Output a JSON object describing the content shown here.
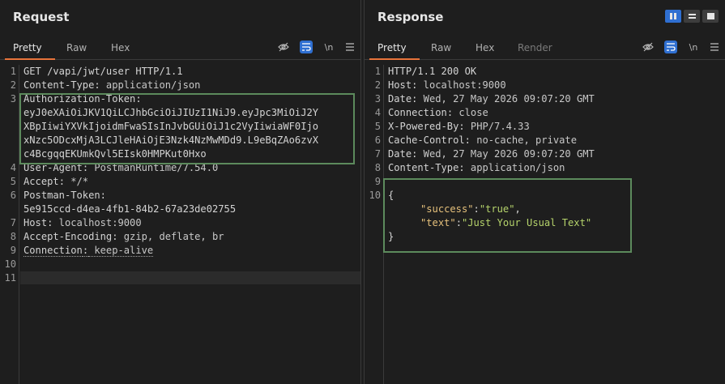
{
  "request": {
    "title": "Request",
    "tabs": [
      {
        "label": "Pretty",
        "active": true
      },
      {
        "label": "Raw",
        "active": false
      },
      {
        "label": "Hex",
        "active": false
      }
    ],
    "toolbar": {
      "newline_label": "\\n"
    },
    "lines": [
      {
        "num": "1",
        "name": "GET /vapi/jwt/user HTTP/1.1",
        "value": ""
      },
      {
        "num": "2",
        "name": "Content-Type",
        "value": " application/json"
      },
      {
        "num": "3",
        "name": "Authorization-Token",
        "value": ""
      },
      {
        "num": "",
        "name": "",
        "value": "eyJ0eXAiOiJKV1QiLCJhbGciOiJIUzI1NiJ9.eyJpc3MiOiJ2Y"
      },
      {
        "num": "",
        "name": "",
        "value": "XBpIiwiYXVkIjoidmFwaSIsInJvbGUiOiJ1c2VyIiwiaWF0Ijo"
      },
      {
        "num": "",
        "name": "",
        "value": "xNzc5ODcxMjA3LCJleHAiOjE3Nzk4NzMwMDd9.L9eBqZAo6zvX"
      },
      {
        "num": "",
        "name": "",
        "value": "c4BcgqqEKUmkQvl5EIsk0HMPKut0Hxo"
      },
      {
        "num": "4",
        "name": "User-Agent",
        "value": " PostmanRuntime/7.54.0"
      },
      {
        "num": "5",
        "name": "Accept",
        "value": " */*"
      },
      {
        "num": "6",
        "name": "Postman-Token",
        "value": ""
      },
      {
        "num": "",
        "name": "",
        "value": "5e915ccd-d4ea-4fb1-84b2-67a23de02755"
      },
      {
        "num": "7",
        "name": "Host",
        "value": " localhost:9000"
      },
      {
        "num": "8",
        "name": "Accept-Encoding",
        "value": " gzip, deflate, br"
      },
      {
        "num": "9",
        "name": "Connection",
        "value": " keep-alive"
      },
      {
        "num": "10",
        "name": "",
        "value": ""
      },
      {
        "num": "11",
        "name": "",
        "value": ""
      }
    ]
  },
  "response": {
    "title": "Response",
    "tabs": [
      {
        "label": "Pretty",
        "active": true
      },
      {
        "label": "Raw",
        "active": false
      },
      {
        "label": "Hex",
        "active": false
      },
      {
        "label": "Render",
        "active": false
      }
    ],
    "toolbar": {
      "newline_label": "\\n"
    },
    "lines": [
      {
        "num": "1",
        "name": "HTTP/1.1 200 OK",
        "value": ""
      },
      {
        "num": "2",
        "name": "Host",
        "value": " localhost:9000"
      },
      {
        "num": "3",
        "name": "Date",
        "value": " Wed, 27 May 2026 09:07:20 GMT"
      },
      {
        "num": "4",
        "name": "Connection",
        "value": " close"
      },
      {
        "num": "5",
        "name": "X-Powered-By",
        "value": " PHP/7.4.33"
      },
      {
        "num": "6",
        "name": "Cache-Control",
        "value": " no-cache, private"
      },
      {
        "num": "7",
        "name": "Date",
        "value": " Wed, 27 May 2026 09:07:20 GMT"
      },
      {
        "num": "8",
        "name": "Content-Type",
        "value": " application/json"
      },
      {
        "num": "9",
        "name": "",
        "value": ""
      },
      {
        "num": "10",
        "name": "{",
        "value": ""
      }
    ],
    "json_body": {
      "success_key": "\"success\"",
      "success_val": "\"true\"",
      "text_key": "\"text\"",
      "text_val": "\"Just Your Usual Text\"",
      "close_brace": "}"
    }
  }
}
